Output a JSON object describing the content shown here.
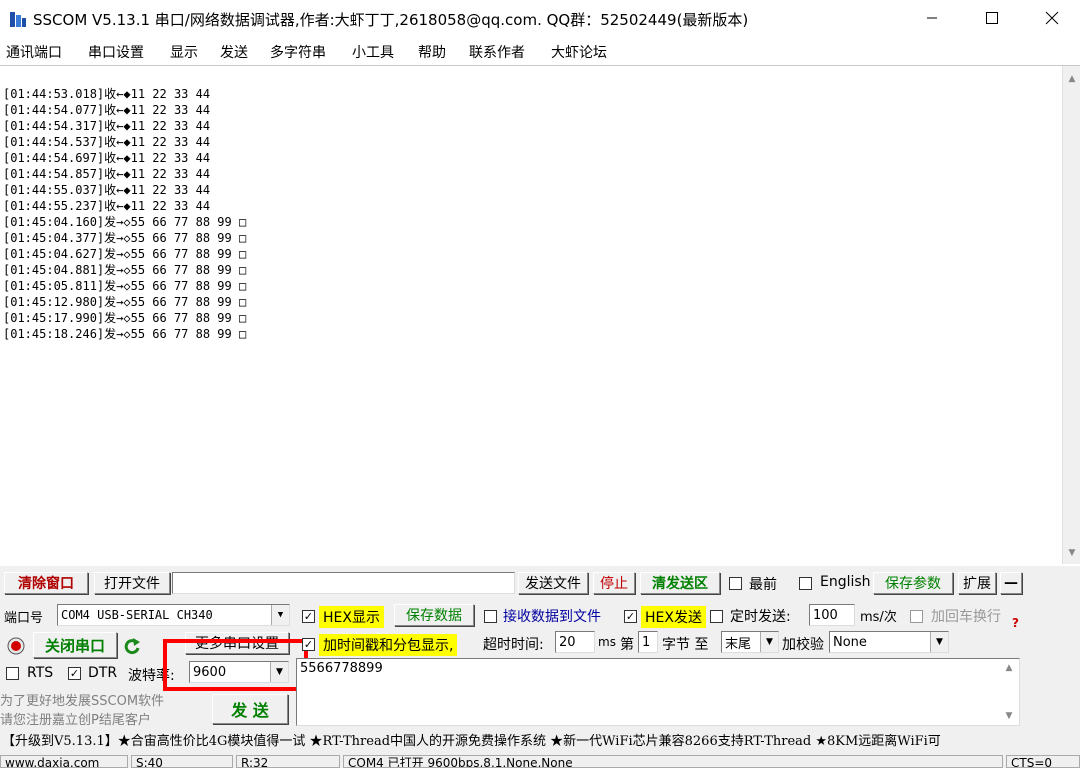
{
  "window": {
    "title": "SSCOM V5.13.1 串口/网络数据调试器,作者:大虾丁丁,2618058@qq.com. QQ群：52502449(最新版本)"
  },
  "menu": [
    "通讯端口",
    "串口设置",
    "显示",
    "发送",
    "多字符串",
    "小工具",
    "帮助",
    "联系作者",
    "大虾论坛"
  ],
  "log": [
    "[01:44:53.018]收←◆11 22 33 44",
    "[01:44:54.077]收←◆11 22 33 44",
    "[01:44:54.317]收←◆11 22 33 44",
    "[01:44:54.537]收←◆11 22 33 44",
    "[01:44:54.697]收←◆11 22 33 44",
    "[01:44:54.857]收←◆11 22 33 44",
    "[01:44:55.037]收←◆11 22 33 44",
    "[01:44:55.237]收←◆11 22 33 44",
    "[01:45:04.160]发→◇55 66 77 88 99 □",
    "[01:45:04.377]发→◇55 66 77 88 99 □",
    "[01:45:04.627]发→◇55 66 77 88 99 □",
    "[01:45:04.881]发→◇55 66 77 88 99 □",
    "[01:45:05.811]发→◇55 66 77 88 99 □",
    "[01:45:12.980]发→◇55 66 77 88 99 □",
    "[01:45:17.990]发→◇55 66 77 88 99 □",
    "[01:45:18.246]发→◇55 66 77 88 99 □"
  ],
  "toolbar": {
    "clear_window": "清除窗口",
    "open_file": "打开文件",
    "file_path": "",
    "send_file": "发送文件",
    "stop": "停止",
    "clear_send": "清发送区",
    "topmost": "最前",
    "english": "English",
    "save_params": "保存参数",
    "expand": "扩展",
    "collapse": "—"
  },
  "port": {
    "label": "端口号",
    "value": "COM4 USB-SERIAL CH340",
    "close_port": "关闭串口",
    "more_settings": "更多串口设置",
    "rts": "RTS",
    "dtr": "DTR",
    "baud_label": "波特率:",
    "baud_value": "9600"
  },
  "options": {
    "hex_display": "HEX显示",
    "save_data": "保存数据",
    "recv_to_file": "接收数据到文件",
    "hex_send": "HEX发送",
    "timed_send": "定时发送:",
    "interval": "100",
    "interval_unit": "ms/次",
    "add_crlf": "加回车换行",
    "timestamp": "加时间戳和分包显示,",
    "timeout_label": "超时时间:",
    "timeout_value": "20",
    "timeout_unit": "ms",
    "byte_prefix": "第",
    "byte_index": "1",
    "byte_suffix": "字节 至",
    "end_value": "末尾",
    "checksum_label": "加校验",
    "checksum_value": "None",
    "help": "?"
  },
  "send": {
    "text": "5566778899",
    "button": "发 送",
    "promo_1": "为了更好地发展SSCOM软件",
    "promo_2": "请您注册嘉立创P结尾客户"
  },
  "ticker": "【升级到V5.13.1】★合宙高性价比4G模块值得一试 ★RT-Thread中国人的开源免费操作系统 ★新一代WiFi芯片兼容8266支持RT-Thread ★8KM远距离WiFi可",
  "status": {
    "site": "www.daxia.com",
    "sent": "S:40",
    "recv": "R:32",
    "port_state": "COM4 已打开  9600bps,8,1,None,None",
    "cts": "CTS=0"
  },
  "colors": {
    "highlight": "#ffff00",
    "accent_green": "#008000",
    "annotation_red": "#ff0000",
    "stop_red": "#c00000",
    "clear_btn_red": "#b00000"
  }
}
